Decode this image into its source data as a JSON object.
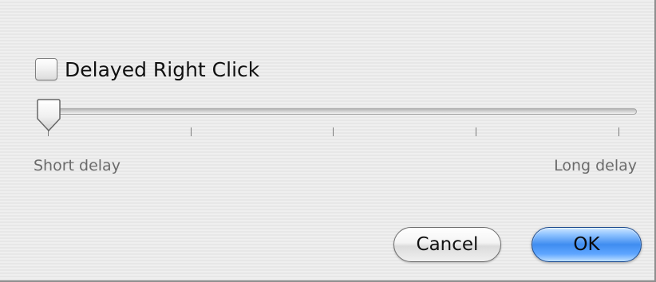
{
  "dialog": {
    "checkbox": {
      "label": "Delayed Right Click",
      "checked": false
    },
    "slider": {
      "min_label": "Short delay",
      "max_label": "Long delay",
      "value": 0,
      "tick_count": 5
    },
    "buttons": {
      "cancel_label": "Cancel",
      "ok_label": "OK"
    },
    "colors": {
      "default_button": "#3f8df0",
      "background": "#ececec"
    },
    "icons": {
      "slider_thumb": "slider-thumb-icon"
    }
  }
}
